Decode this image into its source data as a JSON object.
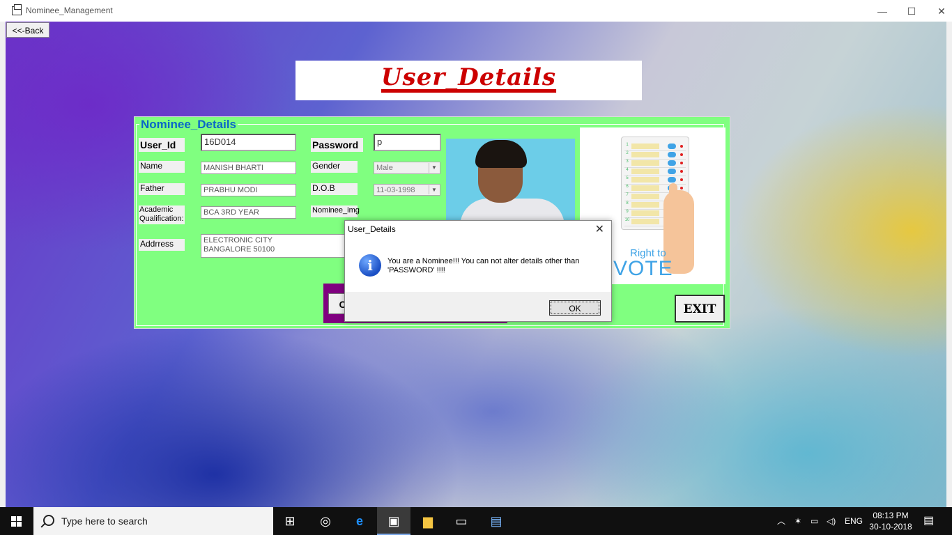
{
  "window": {
    "title": "Nominee_Management",
    "minimize": "—",
    "maximize": "☐",
    "close": "✕"
  },
  "toolbar": {
    "back_label": "<<-Back"
  },
  "header": {
    "title": "User_Details"
  },
  "group": {
    "title": "Nominee_Details"
  },
  "fields": {
    "user_id_label": "User_Id",
    "user_id_value": "16D014",
    "password_label": "Password",
    "password_value": "p",
    "name_label": "Name",
    "name_value": "MANISH BHARTI",
    "gender_label": "Gender",
    "gender_value": "Male",
    "father_label": "Father",
    "father_value": "PRABHU MODI",
    "dob_label": "D.O.B",
    "dob_value": "11-03-1998",
    "qualification_label": "Academic\nQualification:",
    "qualification_value": "BCA 3RD YEAR",
    "nominee_img_label": "Nominee_img",
    "address_label": "Addrress",
    "address_value": "ELECTRONIC CITY\nBANGALORE 50100"
  },
  "vote_image": {
    "right_to": "Right to",
    "vote": "VOTE"
  },
  "buttons": {
    "c_label": "C",
    "exit_label": "EXIT"
  },
  "dialog": {
    "title": "User_Details",
    "message_line1": "You are a Nominee!!! You can not alter details other than",
    "message_line2": "'PASSWORD' !!!!",
    "ok_label": "OK",
    "icon": "info-icon"
  },
  "taskbar": {
    "search_placeholder": "Type here to search",
    "language": "ENG",
    "time": "08:13 PM",
    "date": "30-10-2018"
  },
  "colors": {
    "panel_bg": "#80ff80",
    "header_title": "#cc0000",
    "group_title": "#0a66c8",
    "purple_block": "#800080"
  }
}
